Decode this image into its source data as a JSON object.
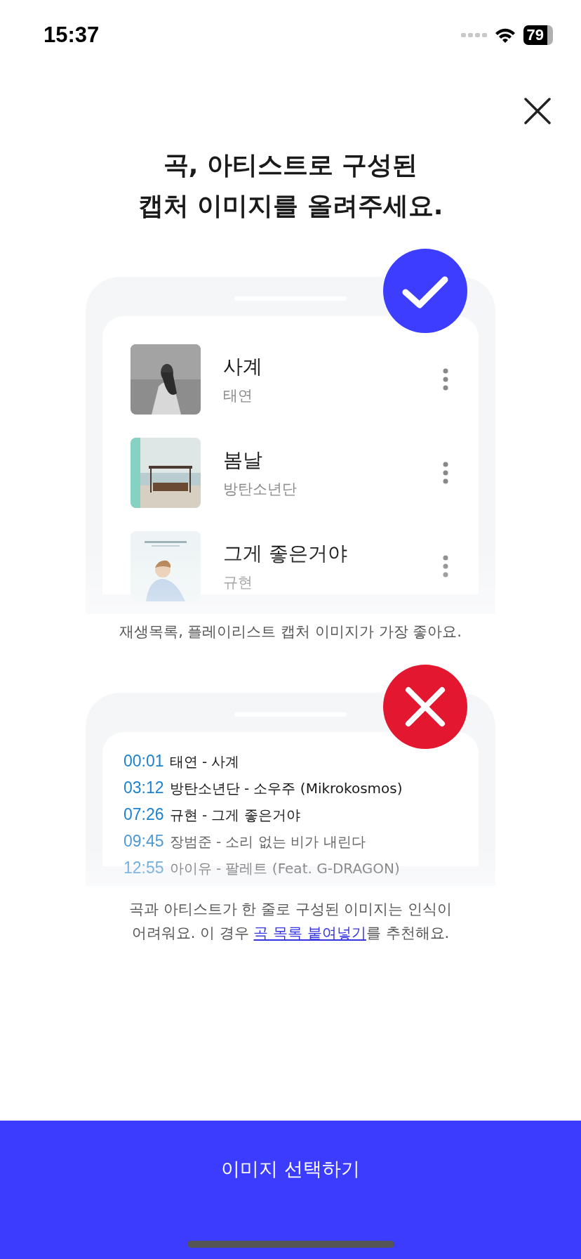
{
  "status_bar": {
    "time": "15:37",
    "battery": "79"
  },
  "title_lines": [
    "곡, 아티스트로 구성된",
    "캡처 이미지를 올려주세요."
  ],
  "good_example": {
    "songs": [
      {
        "title": "사계",
        "artist": "태연"
      },
      {
        "title": "봄날",
        "artist": "방탄소년단"
      },
      {
        "title": "그게 좋은거야",
        "artist": "규현"
      }
    ],
    "caption": "재생목록, 플레이리스트 캡처 이미지가 가장 좋아요."
  },
  "bad_example": {
    "lines": [
      {
        "time": "00:01",
        "text": "태연 - 사계"
      },
      {
        "time": "03:12",
        "text": "방탄소년단 - 소우주 (Mikrokosmos)"
      },
      {
        "time": "07:26",
        "text": "규현 - 그게 좋은거야"
      },
      {
        "time": "09:45",
        "text": "장범준 - 소리 없는 비가 내린다"
      },
      {
        "time": "12:55",
        "text": "아이유 - 팔레트 (Feat. G-DRAGON)"
      }
    ],
    "caption_lines": [
      "곡과 아티스트가 한 줄로 구성된 이미지는 인식이"
    ],
    "caption_before": "어려워요. 이 경우 ",
    "caption_link": "곡 목록 붙여넣기",
    "caption_after": "를 추천해요."
  },
  "primary_button": "이미지 선택하기"
}
